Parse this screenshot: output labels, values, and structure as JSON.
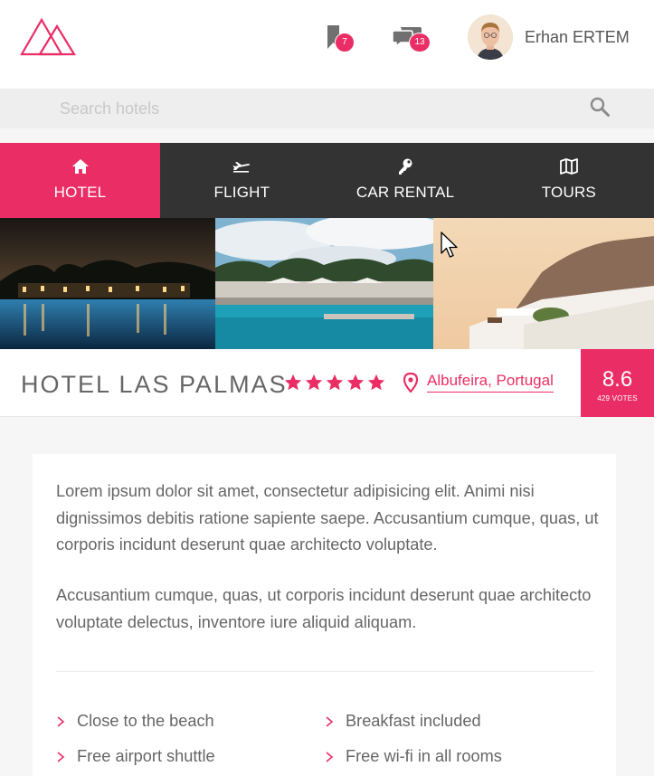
{
  "header": {
    "bookmark_count": "7",
    "message_count": "13",
    "user_name": "Erhan ERTEM"
  },
  "search": {
    "placeholder": "Search hotels",
    "value": ""
  },
  "tabs": [
    {
      "label": "HOTEL",
      "icon": "home-icon",
      "active": true
    },
    {
      "label": "FLIGHT",
      "icon": "plane-icon",
      "active": false
    },
    {
      "label": "CAR RENTAL",
      "icon": "key-icon",
      "active": false
    },
    {
      "label": "TOURS",
      "icon": "map-icon",
      "active": false
    }
  ],
  "hotel": {
    "name": "HOTEL LAS PALMAS",
    "stars": 5,
    "location": "Albufeira, Portugal",
    "score": "8.6",
    "votes": "429 VOTES"
  },
  "content": {
    "paragraphs": [
      "Lorem ipsum dolor sit amet, consectetur adipisicing elit. Animi nisi dignissimos debitis ratione sapiente saepe. Accusantium cumque, quas, ut corporis incidunt deserunt quae architecto voluptate.",
      "Accusantium cumque, quas, ut corporis incidunt deserunt quae architecto voluptate delectus, inventore iure aliquid aliquam."
    ],
    "amenities": [
      "Close to the beach",
      "Breakfast included",
      "Free airport shuttle",
      "Free wi-fi in all rooms"
    ]
  },
  "colors": {
    "accent": "#ea2e65",
    "dark_nav": "#333333",
    "search_bg": "#eeeeee",
    "page_bg": "#f6f6f6"
  }
}
